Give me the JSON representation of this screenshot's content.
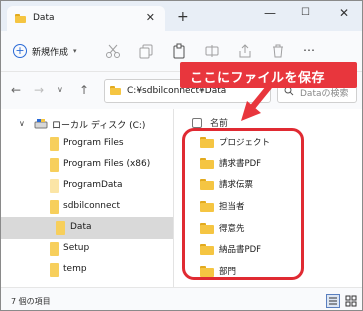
{
  "window": {
    "tab_title": "Data",
    "controls": [
      "minimize-icon",
      "maximize-icon",
      "close-icon"
    ]
  },
  "toolbar": {
    "new_label": "新規作成",
    "icons": [
      "cut-icon",
      "copy-icon",
      "paste-icon",
      "rename-icon",
      "share-icon",
      "delete-icon",
      "more-icon"
    ]
  },
  "address": {
    "path": "C:¥sdbilconnect¥Data",
    "search_placeholder": "Dataの検索"
  },
  "sidebar": {
    "drive": "ローカル ディスク (C:)",
    "items": [
      {
        "label": "Program Files"
      },
      {
        "label": "Program Files (x86)"
      },
      {
        "label": "ProgramData"
      },
      {
        "label": "sdbilconnect"
      },
      {
        "label": "Data",
        "selected": true
      },
      {
        "label": "Setup"
      },
      {
        "label": "temp"
      }
    ]
  },
  "list": {
    "column_name": "名前",
    "folders": [
      "プロジェクト",
      "請求書PDF",
      "請求伝票",
      "担当者",
      "得意先",
      "納品書PDF",
      "部門"
    ]
  },
  "annotation": {
    "text": "ここにファイルを保存",
    "color": "#e8363d"
  },
  "status": {
    "count": "7 個の項目"
  },
  "colors": {
    "folder": "#f5c542",
    "accent": "#2a6ad6",
    "highlight": "#e02a32"
  }
}
